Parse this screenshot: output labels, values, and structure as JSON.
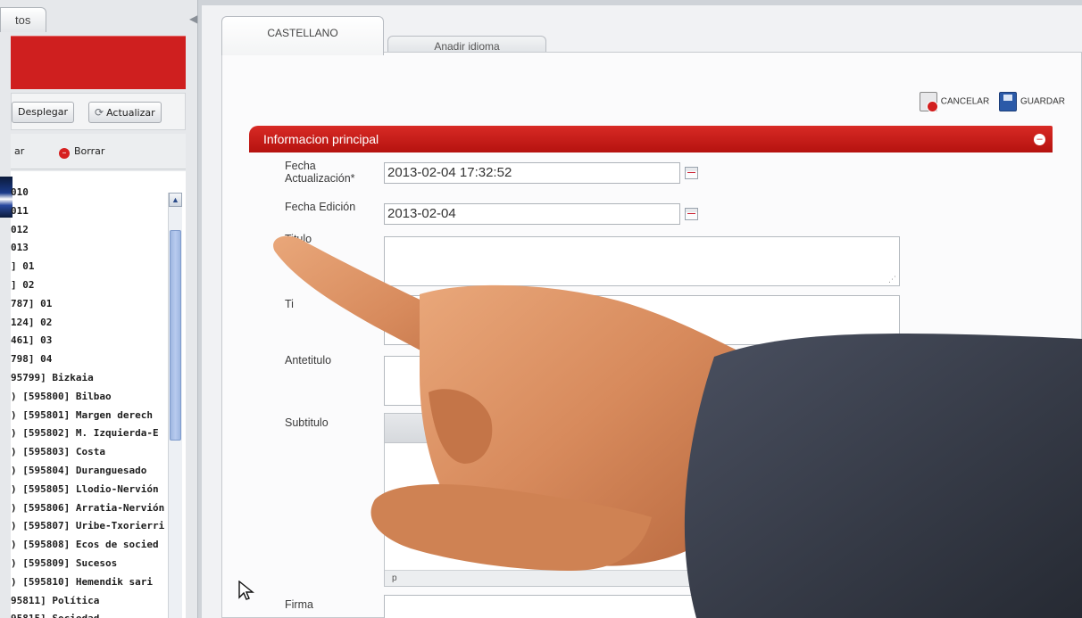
{
  "left_panel": {
    "tab_label": "tos",
    "toolbar_primary": {
      "expand_label": "Desplegar",
      "refresh_label": "Actualizar"
    },
    "toolbar_secondary": {
      "left_fragment": "ar",
      "delete_label": "Borrar"
    },
    "list_items": [
      "010",
      "011",
      "012",
      "013",
      "] 01",
      "] 02",
      "787] 01",
      "124] 02",
      "461] 03",
      "798] 04",
      "95799] Bizkaia",
      ") [595800] Bilbao",
      ") [595801] Margen derech",
      ") [595802] M. Izquierda-E",
      ") [595803] Costa",
      ") [595804] Duranguesado",
      ") [595805] Llodio-Nervión",
      ") [595806] Arratia-Nervión",
      ") [595807] Uribe-Txorierri",
      ") [595808] Ecos de socied",
      ") [595809] Sucesos",
      ") [595810] Hemendik sari",
      "95811] Política",
      "95815] Sociedad"
    ]
  },
  "main": {
    "tabs": {
      "active": "CASTELLANO",
      "add": "Anadir idioma"
    },
    "actions": {
      "cancel": "CANCELAR",
      "save": "GUARDAR"
    },
    "section_title": "Informacion principal",
    "fields": {
      "fecha_actualizacion_label_line1": "Fecha",
      "fecha_actualizacion_label_line2": "Actualización*",
      "fecha_actualizacion_value": "2013-02-04 17:32:52",
      "fecha_edicion_label": "Fecha Edición",
      "fecha_edicion_value": "2013-02-04",
      "titulo_label": "Titulo",
      "second_label_fragment": "Ti",
      "antetitulo_label": "Antetitulo",
      "subtitulo_label": "Subtitulo",
      "editor_status": "p",
      "firma_label": "Firma"
    }
  },
  "colors": {
    "accent_red": "#c8181a",
    "panel_bg": "#f1f2f4",
    "scroll_thumb": "#a9c0ea"
  },
  "icons": [
    "search-icon",
    "refresh-icon",
    "delete-icon",
    "calendar-icon",
    "cancel-icon",
    "save-icon",
    "collapse-icon",
    "mouse-pointer-icon"
  ]
}
